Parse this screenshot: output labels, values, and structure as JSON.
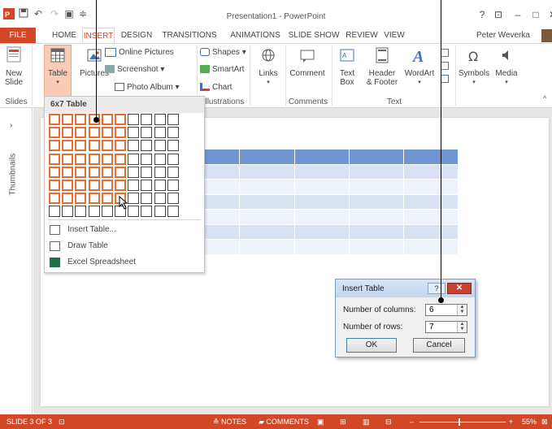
{
  "window": {
    "title": "Presentation1 - PowerPoint",
    "user": "Peter Weverka"
  },
  "tabs": [
    "FILE",
    "HOME",
    "INSERT",
    "DESIGN",
    "TRANSITIONS",
    "ANIMATIONS",
    "SLIDE SHOW",
    "REVIEW",
    "VIEW"
  ],
  "ribbon": {
    "new_slide": "New\nSlide",
    "table": "Table",
    "pictures": "Pictures",
    "online_pictures": "Online Pictures",
    "screenshot": "Screenshot",
    "photo_album": "Photo Album",
    "shapes": "Shapes",
    "smartart": "SmartArt",
    "chart": "Chart",
    "links": "Links",
    "comment": "Comment",
    "text_box": "Text\nBox",
    "header_footer": "Header\n& Footer",
    "wordart": "WordArt",
    "symbols": "Symbols",
    "media": "Media",
    "groups": {
      "slides": "Slides",
      "illustrations": "Illustrations",
      "comments": "Comments",
      "text": "Text"
    }
  },
  "thumbnails_label": "Thumbnails",
  "table_dropdown": {
    "title": "6x7 Table",
    "grid_cols": 10,
    "grid_rows": 8,
    "selected_cols": 6,
    "selected_rows": 7,
    "items": [
      "Insert Table...",
      "Draw Table",
      "Excel Spreadsheet"
    ]
  },
  "dialog": {
    "title": "Insert Table",
    "help": "?",
    "columns_label": "Number of columns:",
    "columns_value": "6",
    "rows_label": "Number of rows:",
    "rows_value": "7",
    "ok": "OK",
    "cancel": "Cancel"
  },
  "status": {
    "slide": "SLIDE 3 OF 3",
    "notes": "NOTES",
    "comments": "COMMENTS",
    "zoom": "55%"
  },
  "colors": {
    "accent": "#d24726",
    "selection": "#e86c32",
    "table_header": "#6d95cf",
    "table_band": "#d9e2f3"
  }
}
